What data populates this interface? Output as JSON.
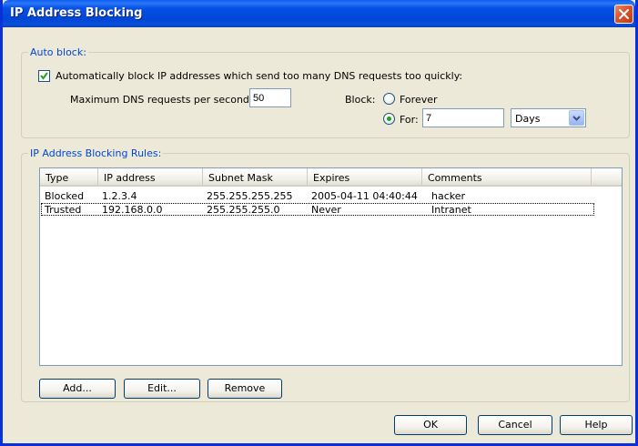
{
  "window": {
    "title": "IP Address Blocking"
  },
  "auto_block": {
    "legend": "Auto block:",
    "auto_checkbox": {
      "label": "Automatically block IP addresses which send too many DNS requests too quickly:",
      "checked": true
    },
    "max_requests_label": "Maximum DNS requests per second:",
    "max_requests_value": "50",
    "block_label": "Block:",
    "forever_label": "Forever",
    "for_label": "For:",
    "for_value": "7",
    "unit_selected": "Days",
    "selected_option": "for"
  },
  "rules": {
    "legend": "IP Address Blocking Rules:",
    "columns": [
      "Type",
      "IP address",
      "Subnet Mask",
      "Expires",
      "Comments"
    ],
    "rows": [
      {
        "type": "Blocked",
        "ip": "1.2.3.4",
        "mask": "255.255.255.255",
        "expires": "2005-04-11 04:40:44",
        "comments": "hacker"
      },
      {
        "type": "Trusted",
        "ip": "192.168.0.0",
        "mask": "255.255.255.0",
        "expires": "Never",
        "comments": "Intranet"
      }
    ],
    "add_label": "Add...",
    "edit_label": "Edit...",
    "remove_label": "Remove"
  },
  "footer": {
    "ok_label": "OK",
    "cancel_label": "Cancel",
    "help_label": "Help"
  },
  "colors": {
    "titlebar": "#0551e5",
    "dialog_bg": "#ece9d8",
    "group_legend": "#0046d5",
    "close_button": "#d9542c",
    "radio_dot": "#21a121"
  }
}
